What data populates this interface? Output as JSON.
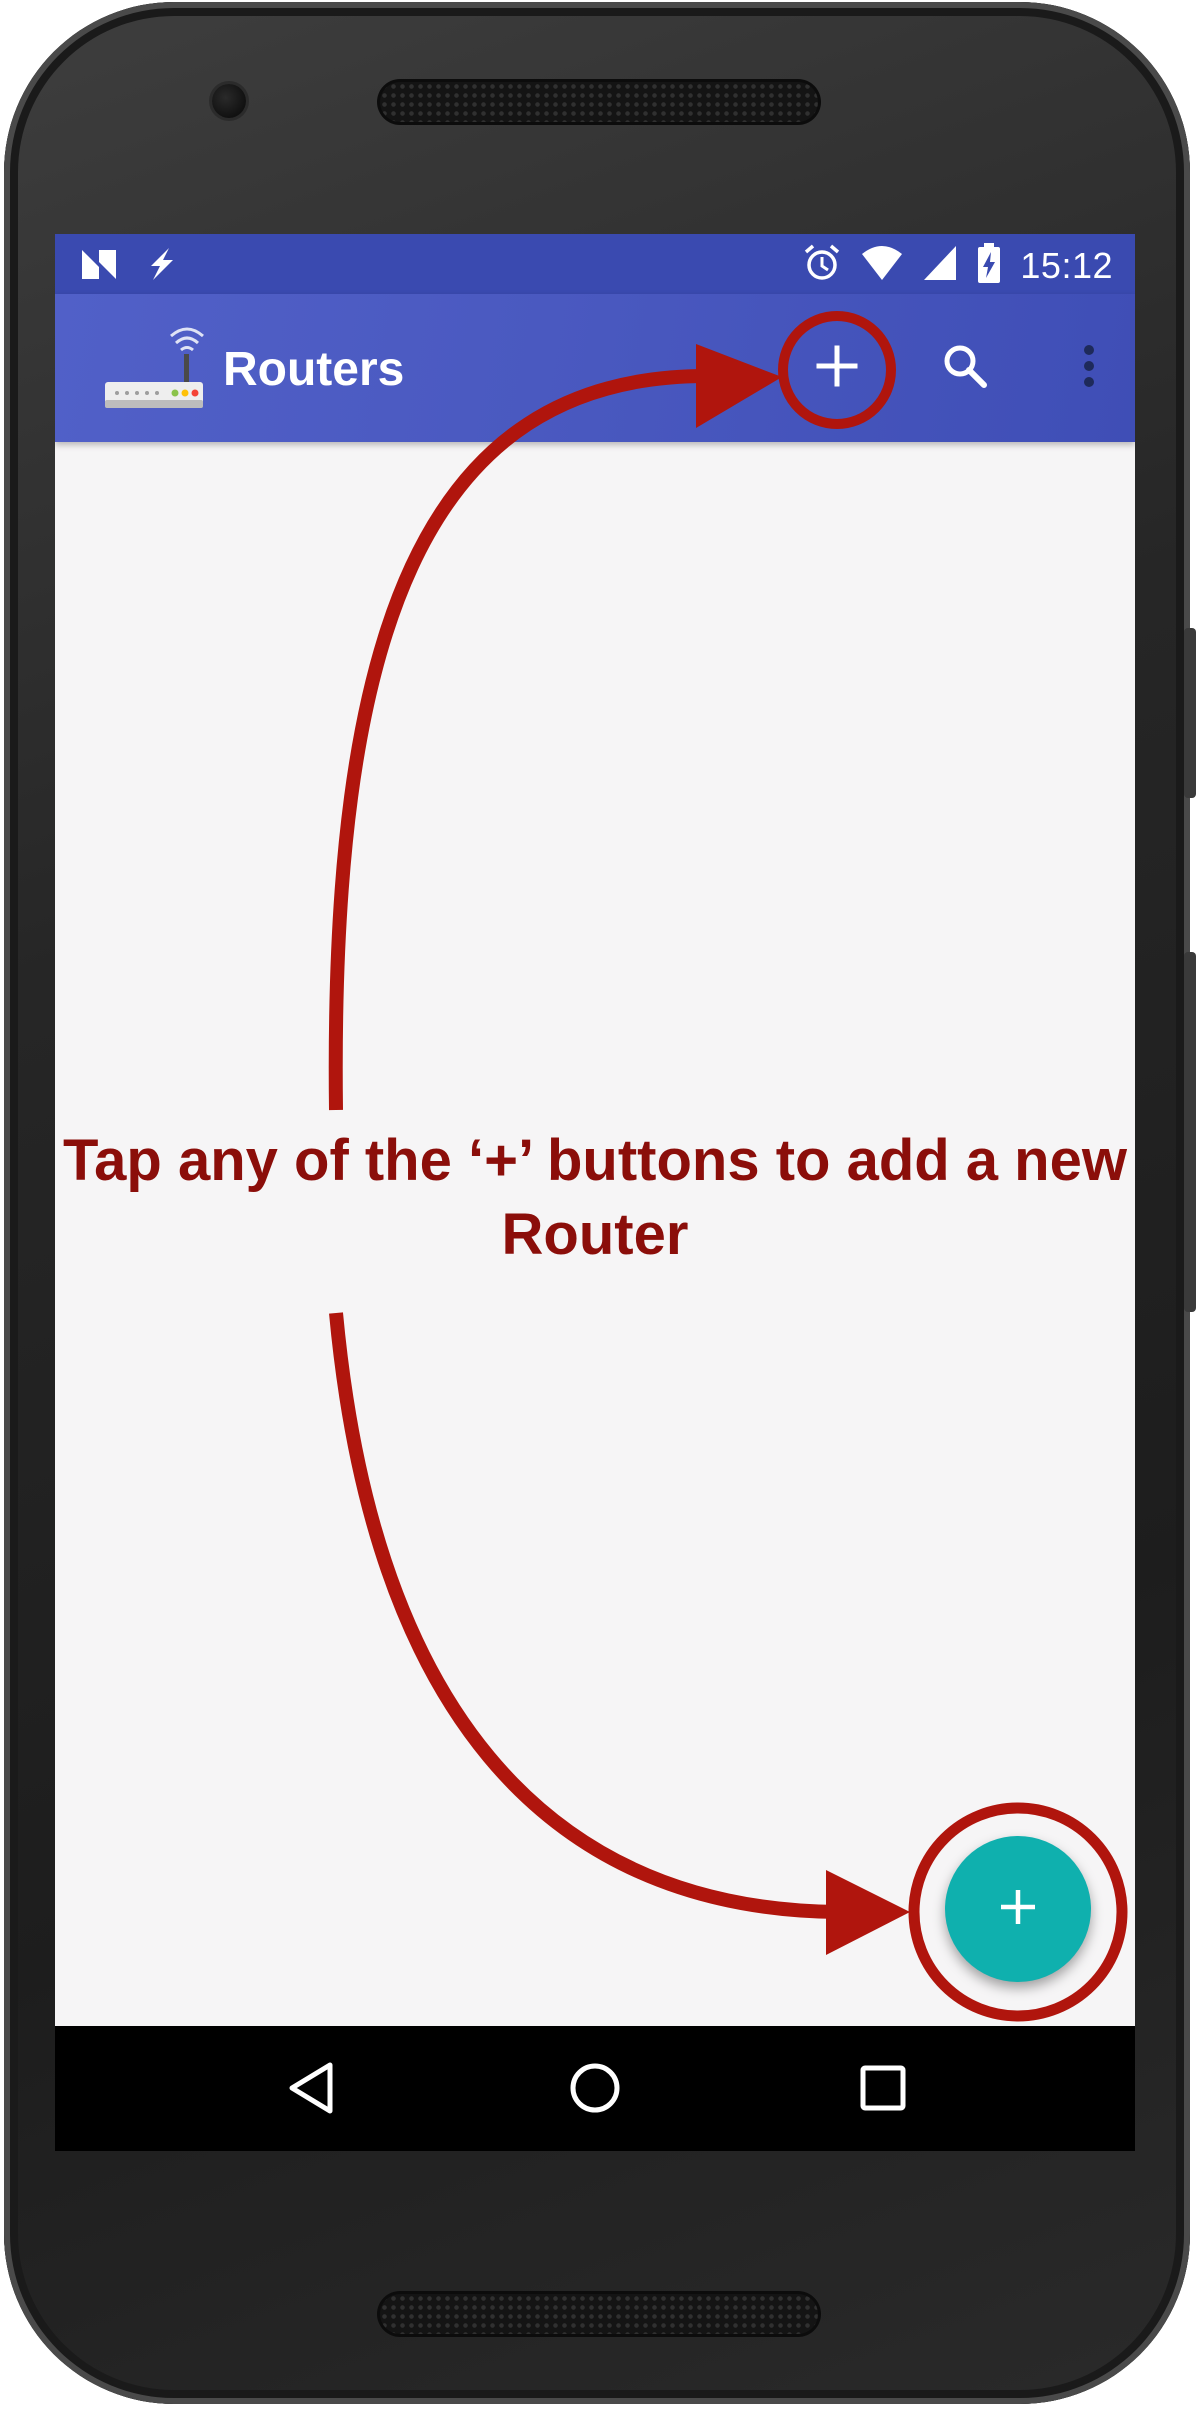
{
  "status_bar": {
    "time": "15:12",
    "left_icons": [
      "n-preview-icon",
      "flash-icon"
    ],
    "right_icons": [
      "alarm-icon",
      "wifi-icon",
      "signal-icon",
      "battery-charging-icon"
    ]
  },
  "app_bar": {
    "title": "Routers",
    "logo_icon": "router-icon",
    "actions": [
      "add-icon",
      "search-icon",
      "more-vert-icon"
    ]
  },
  "annotation": {
    "text": "Tap any of the ‘+’ buttons to add a new Router",
    "color": "#8b0e0a",
    "arrow_color": "#b0150d"
  },
  "fab": {
    "icon": "add-icon",
    "color": "#0fb0ae"
  },
  "nav_bar": {
    "buttons": [
      "back-icon",
      "home-icon",
      "recents-icon"
    ]
  },
  "colors": {
    "app_bar": "#4a59c0",
    "status_bar": "#3a4ab0",
    "background": "#f6f5f6"
  }
}
